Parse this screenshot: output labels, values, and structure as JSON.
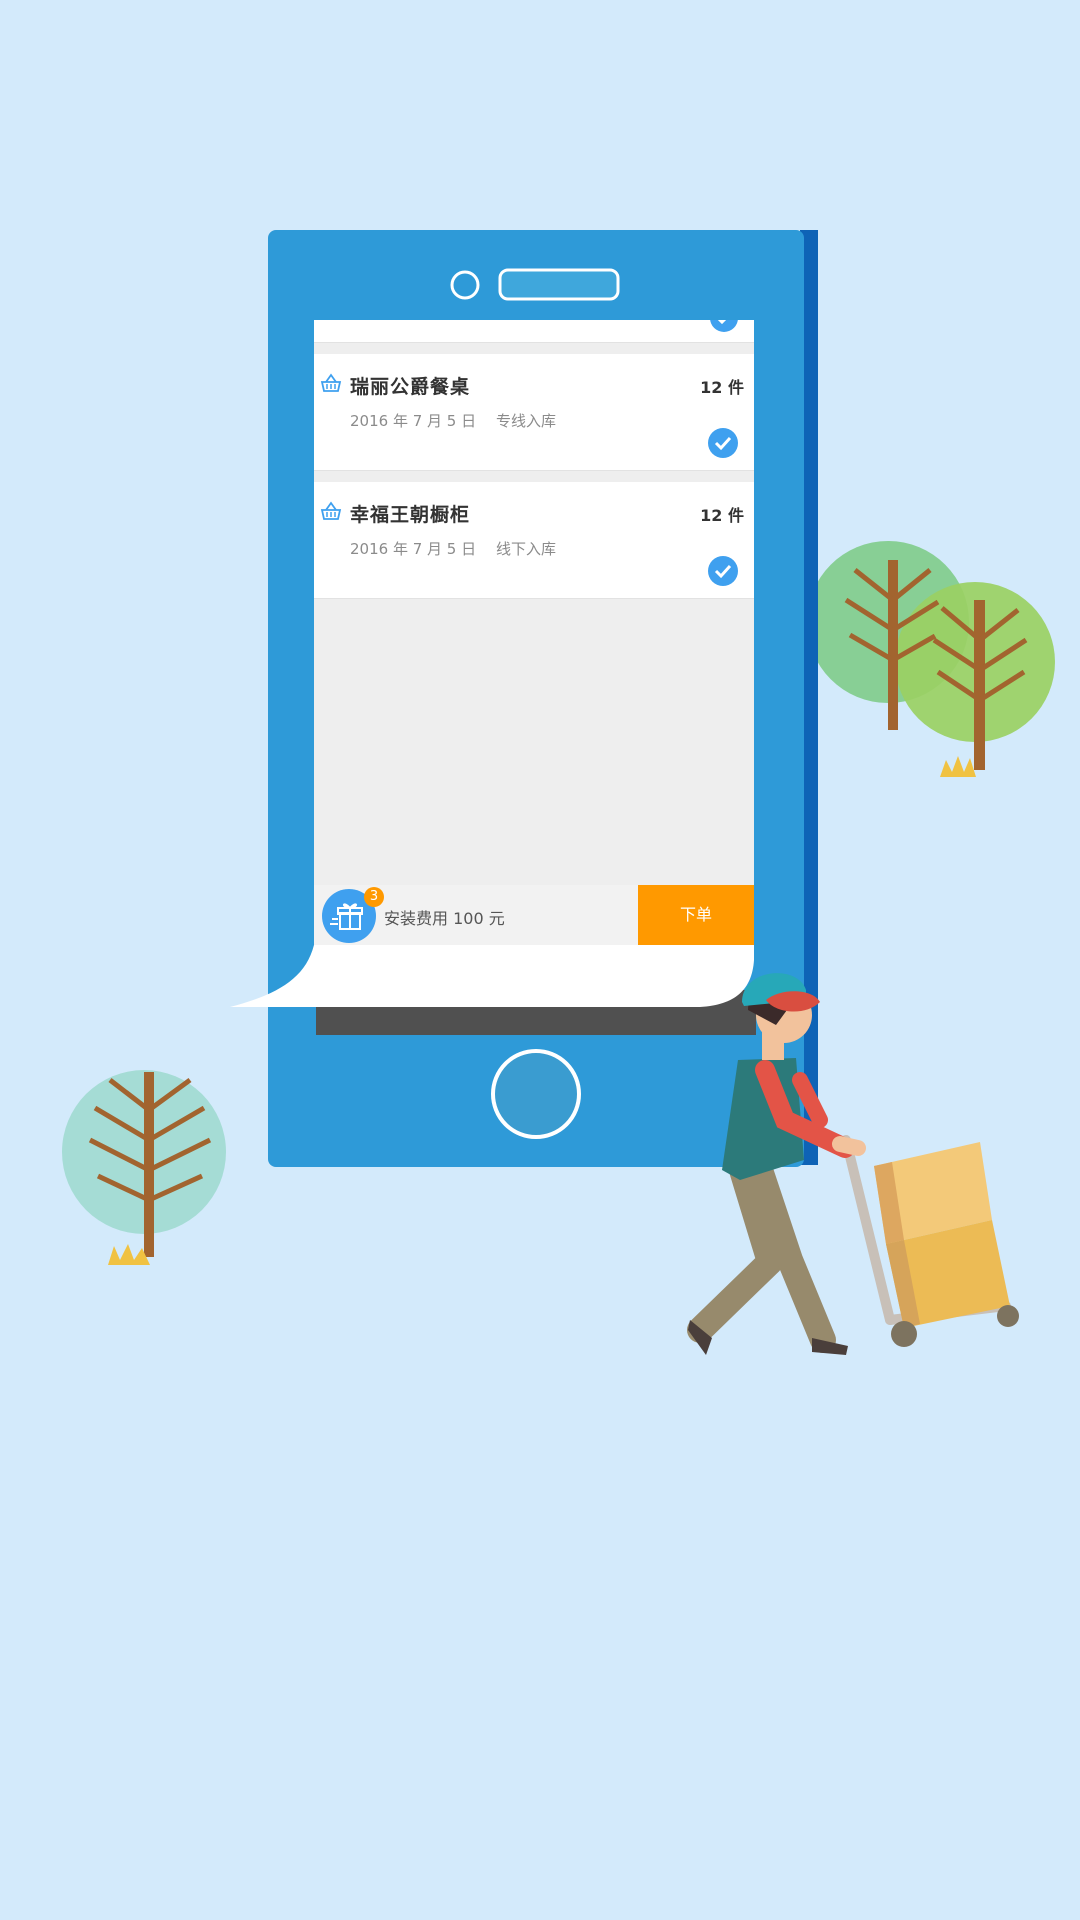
{
  "list": {
    "items": [
      {
        "name": "瑞丽公爵餐桌",
        "qty": "12 件",
        "date": "2016 年 7 月 5 日",
        "method": "专线入库",
        "icon": "basket-icon",
        "checked": true
      },
      {
        "name": "幸福王朝橱柜",
        "qty": "12 件",
        "date": "2016 年 7 月 5 日",
        "method": "线下入库",
        "icon": "basket-icon",
        "checked": true
      }
    ]
  },
  "footer": {
    "gift_badge": "3",
    "fee_text": "安装费用 100 元",
    "order_label": "下单"
  },
  "colors": {
    "background": "#d3eafb",
    "phone_body": "#2e9ad8",
    "accent_blue": "#3fa0ef",
    "order_orange": "#ff9900"
  }
}
